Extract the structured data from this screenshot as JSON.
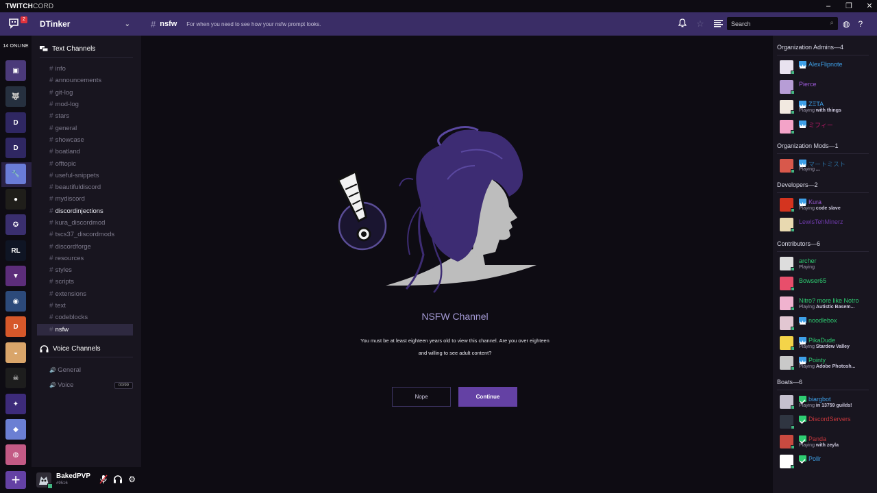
{
  "titlebar": {
    "brand_bold": "TWITCH",
    "brand_light": "CORD",
    "controls": [
      "–",
      "❐",
      "✕"
    ]
  },
  "header": {
    "dm_badge": "2",
    "server_name": "DTinker",
    "channel_hash": "#",
    "channel_name": "nsfw",
    "topic": "For when you need to see how your nsfw prompt looks.",
    "search_placeholder": "Search"
  },
  "rail": {
    "online_count": "14 ONLINE",
    "servers": [
      {
        "name": "twitchcord",
        "color": "#4b3a7a",
        "text": "▣"
      },
      {
        "name": "wolf",
        "color": "#26303f",
        "text": "🐺"
      },
      {
        "name": "bd1",
        "color": "#2f2762",
        "text": "D"
      },
      {
        "name": "bd2",
        "color": "#2f2762",
        "text": "D"
      },
      {
        "name": "dtinker",
        "color": "#6a7cd8",
        "text": "🔧"
      },
      {
        "name": "ball",
        "color": "#1f1e1a",
        "text": "●"
      },
      {
        "name": "crest",
        "color": "#3a2f6e",
        "text": "✪"
      },
      {
        "name": "rocket-league",
        "color": "#0f1524",
        "text": "RL"
      },
      {
        "name": "triangle",
        "color": "#5c2d7a",
        "text": "▼"
      },
      {
        "name": "planet",
        "color": "#2c4a7a",
        "text": "◉"
      },
      {
        "name": "discord",
        "color": "#d6582a",
        "text": "D"
      },
      {
        "name": "food",
        "color": "#d9a56a",
        "text": "◒"
      },
      {
        "name": "skull",
        "color": "#1d1d1d",
        "text": "☠"
      },
      {
        "name": "shield",
        "color": "#3d2b7a",
        "text": "✦"
      },
      {
        "name": "emblem",
        "color": "#6b7fd3",
        "text": "◆"
      },
      {
        "name": "face",
        "color": "#c35a85",
        "text": "◍"
      }
    ],
    "add_label": "+"
  },
  "channels": {
    "text_category": "Text Channels",
    "text": [
      {
        "name": "info",
        "white": false
      },
      {
        "name": "announcements",
        "white": false
      },
      {
        "name": "git-log",
        "white": false
      },
      {
        "name": "mod-log",
        "white": false
      },
      {
        "name": "stars",
        "white": false
      },
      {
        "name": "general",
        "white": false
      },
      {
        "name": "showcase",
        "white": false
      },
      {
        "name": "boatland",
        "white": false
      },
      {
        "name": "offtopic",
        "white": false
      },
      {
        "name": "useful-snippets",
        "white": false
      },
      {
        "name": "beautifuldiscord",
        "white": false
      },
      {
        "name": "mydiscord",
        "white": false
      },
      {
        "name": "discordinjections",
        "white": true
      },
      {
        "name": "kura_discordmod",
        "white": false
      },
      {
        "name": "tscs37_discordmods",
        "white": false
      },
      {
        "name": "discordforge",
        "white": false
      },
      {
        "name": "resources",
        "white": false
      },
      {
        "name": "styles",
        "white": false
      },
      {
        "name": "scripts",
        "white": false
      },
      {
        "name": "extensions",
        "white": false
      },
      {
        "name": "text",
        "white": false
      },
      {
        "name": "codeblocks",
        "white": false
      },
      {
        "name": "nsfw",
        "white": true,
        "selected": true
      }
    ],
    "voice_category": "Voice Channels",
    "voice": [
      {
        "name": "General",
        "count": ""
      },
      {
        "name": "Voice",
        "count": "00/99"
      }
    ]
  },
  "user": {
    "name": "BakedPVP",
    "discriminator": "#9516"
  },
  "main": {
    "title": "NSFW Channel",
    "message": "You must be at least eighteen years old to view this channel. Are you over eighteen and willing to see adult content?",
    "nope_label": "Nope",
    "continue_label": "Continue"
  },
  "members": {
    "groups": [
      {
        "title": "Organization Admins—4",
        "members": [
          {
            "name": "AlexFlipnote",
            "color": "#3ea0e8",
            "badge": "crown",
            "game": "",
            "avatar": "#e8e2ef"
          },
          {
            "name": "Pierce",
            "color": "#9b59d6",
            "badge": "",
            "game": "",
            "avatar": "#b79dd6"
          },
          {
            "name": "ZΞTA",
            "color": "#3ea0e8",
            "badge": "crown",
            "game": "with things",
            "avatar": "#f1e9e0"
          },
          {
            "name": "ミフィー",
            "color": "#c2186b",
            "badge": "crown",
            "game": "",
            "avatar": "#f4a3c8"
          }
        ]
      },
      {
        "title": "Organization Mods—1",
        "members": [
          {
            "name": "マートミスト",
            "color": "#2a6b9a",
            "badge": "crown",
            "game": "...",
            "avatar": "#d8584b"
          }
        ]
      },
      {
        "title": "Developers—2",
        "members": [
          {
            "name": "Kura",
            "color": "#9b59d6",
            "badge": "crown",
            "game": "code slave",
            "avatar": "#d4341f"
          },
          {
            "name": "LewisTehMinerz",
            "color": "#6c3aa8",
            "badge": "",
            "game": "",
            "avatar": "#e8d9b0"
          }
        ]
      },
      {
        "title": "Contributors—6",
        "members": [
          {
            "name": "archer",
            "color": "#2ecc71",
            "badge": "",
            "game": " ",
            "avatar": "#dddddd"
          },
          {
            "name": "Bowser65",
            "color": "#2ecc71",
            "badge": "",
            "game": "",
            "avatar": "#e84e6b"
          },
          {
            "name": "Nitro? more like Notro",
            "color": "#2ecc71",
            "badge": "",
            "game": "Autistic Basem...",
            "avatar": "#f0b3cf"
          },
          {
            "name": "noodlebox",
            "color": "#2ecc71",
            "badge": "crown",
            "game": "",
            "avatar": "#e2c7d2"
          },
          {
            "name": "PikaDude",
            "color": "#2ecc71",
            "badge": "crown",
            "game": "Stardew Valley",
            "avatar": "#f4d449"
          },
          {
            "name": "Pointy",
            "color": "#2ecc71",
            "badge": "crown",
            "game": "Adobe Photosh...",
            "avatar": "#c9c9c9"
          }
        ]
      },
      {
        "title": "Boats—6",
        "members": [
          {
            "name": "biargbot",
            "color": "#3ea0e8",
            "badge": "check",
            "game": "in 13759 guilds!",
            "avatar": "#c6c0cf"
          },
          {
            "name": "DiscordServers",
            "color": "#c9373c",
            "badge": "check",
            "game": "",
            "avatar": "#2f3541"
          },
          {
            "name": "Panda",
            "color": "#c9373c",
            "badge": "check",
            "game": "with zeyla",
            "avatar": "#c94a40"
          },
          {
            "name": "Pollr",
            "color": "#3ea0e8",
            "badge": "check",
            "game": "",
            "avatar": "#ffffff"
          }
        ]
      }
    ],
    "playing_label": "Playing"
  }
}
